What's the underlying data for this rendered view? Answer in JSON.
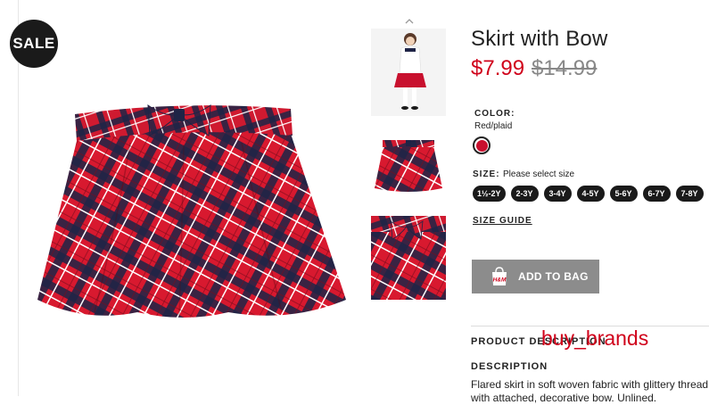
{
  "badge": {
    "sale_label": "SALE"
  },
  "product": {
    "title": "Skirt with Bow",
    "price_sale": "$7.99",
    "price_original": "$14.99"
  },
  "color": {
    "label": "COLOR:",
    "selected_value": "Red/plaid",
    "swatch_color": "#c8102e"
  },
  "size": {
    "label": "SIZE:",
    "hint": "Please select size",
    "options": [
      "1½-2Y",
      "2-3Y",
      "3-4Y",
      "4-5Y",
      "5-6Y",
      "6-7Y",
      "7-8Y"
    ]
  },
  "size_guide_label": "SIZE GUIDE",
  "cart": {
    "add_label": "ADD TO BAG",
    "bag_logo_text": "H&M"
  },
  "sections": {
    "product_description_label": "PRODUCT DESCRIPTION",
    "description_label": "DESCRIPTION",
    "description_text": "Flared skirt in soft woven fabric with glittery thread with attached, decorative bow. Unlined."
  },
  "watermark": "buy_brands",
  "icons": {
    "thumbnail_scroll": "chevron-up-icon",
    "bag": "shopping-bag-icon"
  },
  "colors": {
    "accent_red": "#d0021b",
    "button_gray": "#8c8c8c",
    "pill_black": "#1a1a1a"
  }
}
